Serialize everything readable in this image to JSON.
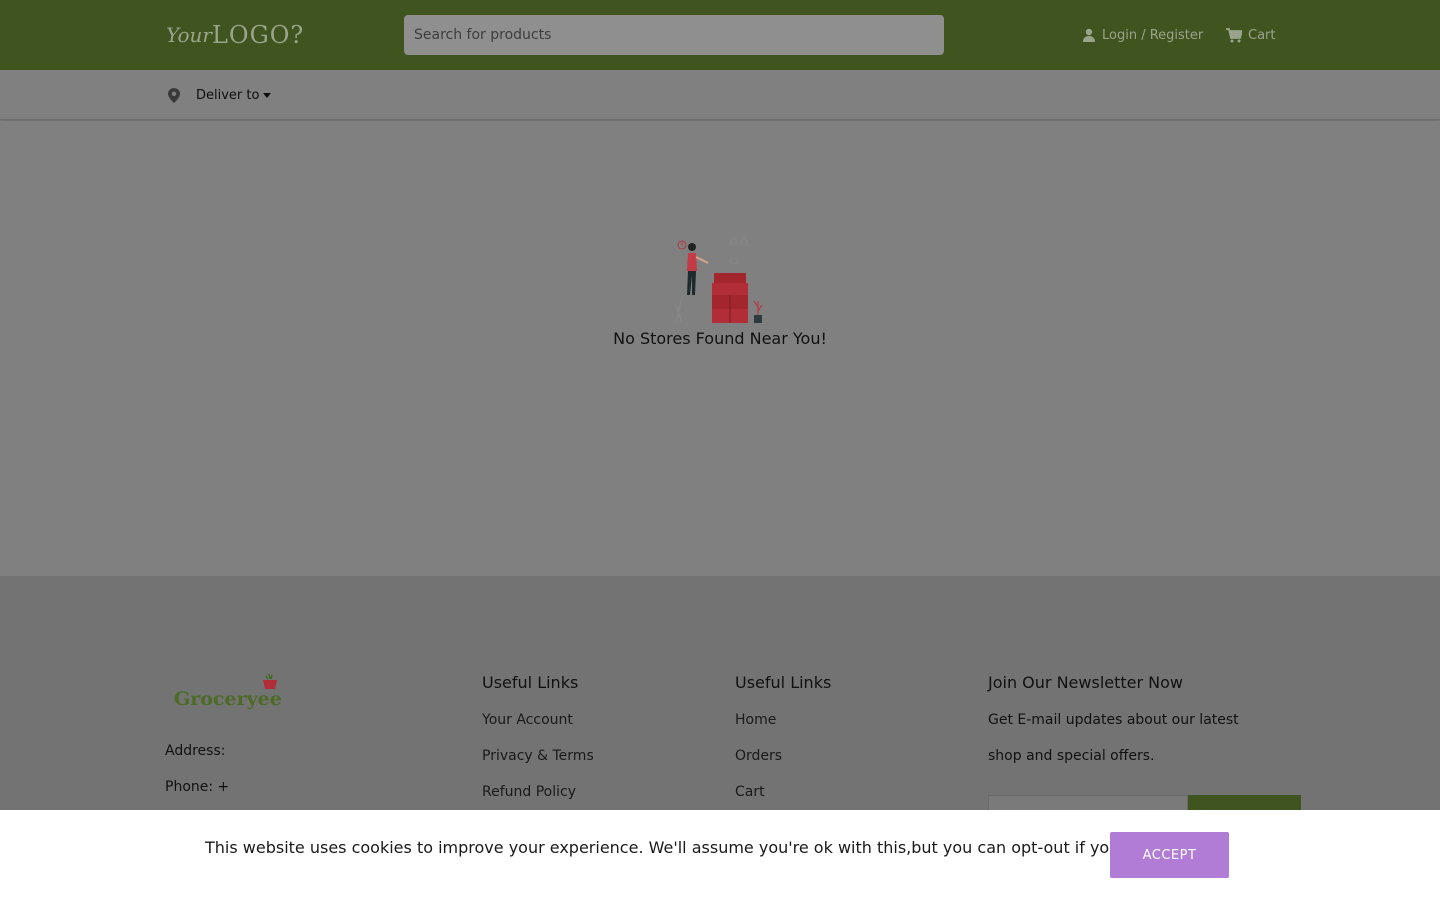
{
  "header": {
    "logo_prefix": "Your",
    "logo_main": "LOGO?",
    "search_placeholder": "Search for products",
    "login_label": "Login / Register",
    "cart_label": "Cart"
  },
  "deliver": {
    "label": "Deliver to"
  },
  "main": {
    "empty_message": "No Stores Found Near You!"
  },
  "footer": {
    "brand_name": "Groceryee",
    "address_label": "Address:",
    "phone_label": "Phone: +",
    "col1": {
      "heading": "Useful Links",
      "links": [
        "Your Account",
        "Privacy & Terms",
        "Refund Policy"
      ]
    },
    "col2": {
      "heading": "Useful Links",
      "links": [
        "Home",
        "Orders",
        "Cart"
      ]
    },
    "newsletter": {
      "heading": "Join Our Newsletter Now",
      "line1": "Get E-mail updates about our latest",
      "line2": "shop and special offers."
    }
  },
  "cookie": {
    "message": "This website uses cookies to improve your experience. We'll assume you're ok with this,but you can opt-out if you wish.",
    "accept_label": "ACCEPT"
  },
  "colors": {
    "header_green": "#3f541f",
    "overlay_gray": "#808080",
    "accept_purple": "#b07cd6",
    "brand_green": "#4c6b26"
  }
}
